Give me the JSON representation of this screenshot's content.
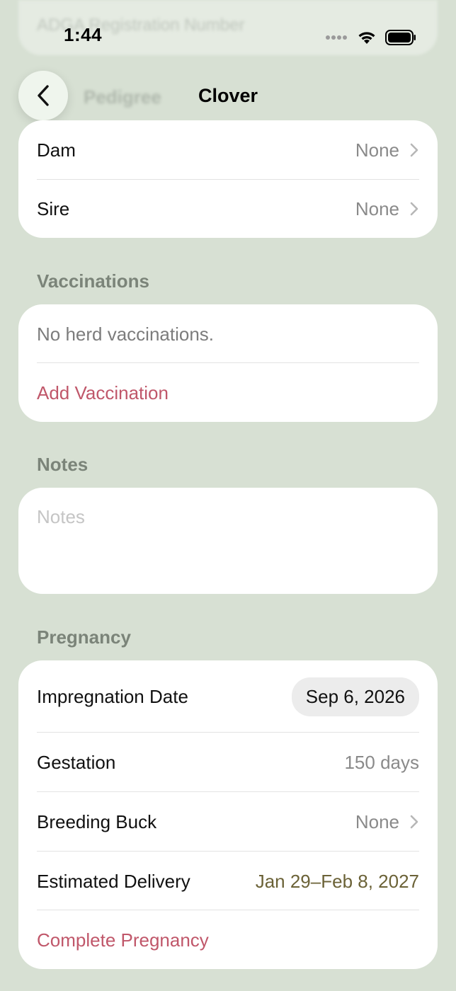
{
  "status_bar": {
    "time": "1:44"
  },
  "nav": {
    "title": "Clover",
    "back_icon": "chevron-left-icon"
  },
  "background_blurred": {
    "top_field_text": "ADGA Registration Number",
    "section_title": "Pedigree"
  },
  "pedigree": {
    "rows": [
      {
        "label": "Dam",
        "value": "None"
      },
      {
        "label": "Sire",
        "value": "None"
      }
    ]
  },
  "vaccinations": {
    "header": "Vaccinations",
    "empty_text": "No herd vaccinations.",
    "add_label": "Add Vaccination"
  },
  "notes": {
    "header": "Notes",
    "placeholder": "Notes"
  },
  "pregnancy": {
    "header": "Pregnancy",
    "impregnation_label": "Impregnation Date",
    "impregnation_value": "Sep 6, 2026",
    "gestation_label": "Gestation",
    "gestation_value": "150 days",
    "buck_label": "Breeding Buck",
    "buck_value": "None",
    "delivery_label": "Estimated Delivery",
    "delivery_value": "Jan 29–Feb 8, 2027",
    "complete_label": "Complete Pregnancy"
  },
  "colors": {
    "background": "#d7e0d3",
    "accent": "#c0576a",
    "delivery_text": "#6b6237"
  }
}
